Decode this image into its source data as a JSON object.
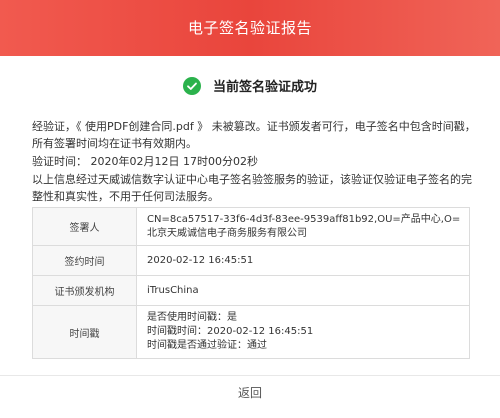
{
  "header": {
    "title": "电子签名验证报告"
  },
  "status": {
    "text": "当前签名验证成功",
    "color": "#2bb24c"
  },
  "content": {
    "paragraph1": "经验证，《 使用PDF创建合同.pdf 》 未被篡改。证书颁发者可行，电子签名中包含时间戳，所有签署时间均在证书有效期内。",
    "verify_time": "验证时间： 2020年02月12日 17时00分02秒",
    "paragraph3": "以上信息经过天威诚信数字认证中心电子签名验签服务的验证，该验证仅验证电子签名的完整性和真实性，不用于任何司法服务。"
  },
  "table": {
    "rows": [
      {
        "label": "签署人",
        "values": [
          "CN=8ca57517-33f6-4d3f-83ee-9539aff81b92,OU=产品中心,O=北京天威诚信电子商务服务有限公司"
        ]
      },
      {
        "label": "签约时间",
        "values": [
          "2020-02-12 16:45:51"
        ]
      },
      {
        "label": "证书颁发机构",
        "values": [
          "iTrusChina"
        ]
      },
      {
        "label": "时间戳",
        "values": [
          "是否使用时间戳：是",
          "时间戳时间：2020-02-12 16:45:51",
          "时间戳是否通过验证：通过"
        ]
      }
    ]
  },
  "footer": {
    "back_label": "返回"
  }
}
